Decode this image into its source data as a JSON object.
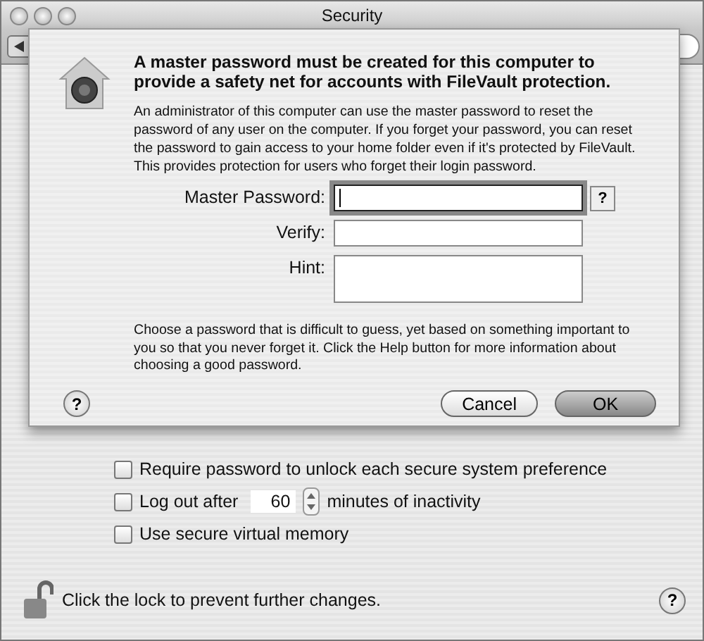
{
  "window": {
    "title": "Security"
  },
  "sheet": {
    "heading": "A master password must be created for this computer to provide a safety net for accounts with FileVault protection.",
    "message": "An administrator of this computer can use the master password to reset the password of any user on the computer. If you forget your password, you can reset the password to gain access to your home folder even if it's protected by FileVault. This provides protection for users who forget their login password.",
    "fields": [
      {
        "label": "Master Password:",
        "focused": true,
        "kind": "line",
        "help_button": "?"
      },
      {
        "label": "Verify:",
        "focused": false,
        "kind": "line"
      },
      {
        "label": "Hint:",
        "focused": false,
        "kind": "area"
      }
    ],
    "advice": "Choose a password that is difficult to guess, yet based on something important to you so that you never forget it. Click the Help button for more information about choosing a good password.",
    "help_button": "?",
    "buttons": [
      {
        "label": "Cancel",
        "default": false
      },
      {
        "label": "OK",
        "default": true
      }
    ]
  },
  "options": [
    {
      "kind": "checkbox",
      "label": "Require password to unlock each secure system preference",
      "checked": false
    },
    {
      "kind": "timeout",
      "label": "Log out after",
      "value": "60",
      "unit": "minutes of inactivity",
      "checked": false
    },
    {
      "kind": "checkbox",
      "label": "Use secure virtual memory",
      "checked": false
    }
  ],
  "footer": {
    "lock_text": "Click the lock to prevent further changes.",
    "locked": false,
    "help_button": "?"
  }
}
